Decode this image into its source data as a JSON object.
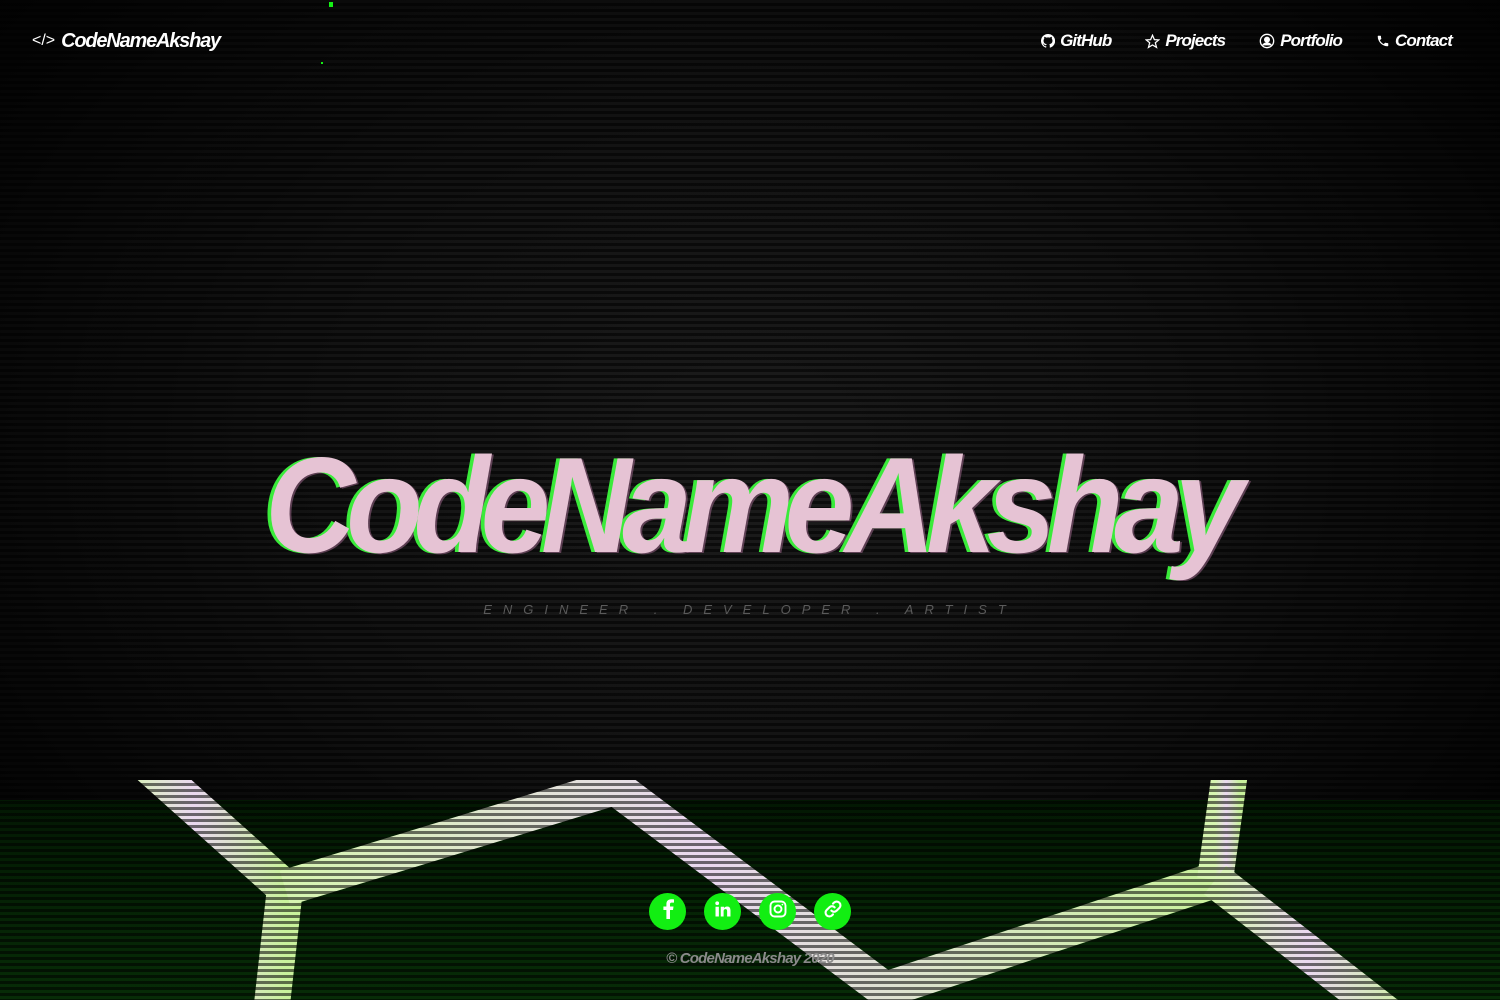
{
  "nav": {
    "brand": "CodeNameAkshay",
    "brand_icon": "code-icon",
    "links": [
      {
        "label": "GitHub",
        "icon": "github-icon"
      },
      {
        "label": "Projects",
        "icon": "star-icon"
      },
      {
        "label": "Portfolio",
        "icon": "user-circle-icon"
      },
      {
        "label": "Contact",
        "icon": "phone-icon"
      }
    ]
  },
  "hero": {
    "title": "CodeNameAkshay",
    "tagline": "ENGINEER . DEVELOPER . ARTIST"
  },
  "socials": [
    {
      "name": "facebook",
      "icon": "facebook-icon"
    },
    {
      "name": "linkedin",
      "icon": "linkedin-icon"
    },
    {
      "name": "instagram",
      "icon": "instagram-icon"
    },
    {
      "name": "link",
      "icon": "link-icon"
    }
  ],
  "footer": {
    "copyright": "© CodeNameAkshay 2020"
  },
  "colors": {
    "accent_green": "#12ee12",
    "title_pink": "#e6c3d4",
    "hex_line": "#c8f5a0",
    "background": "#000000"
  }
}
